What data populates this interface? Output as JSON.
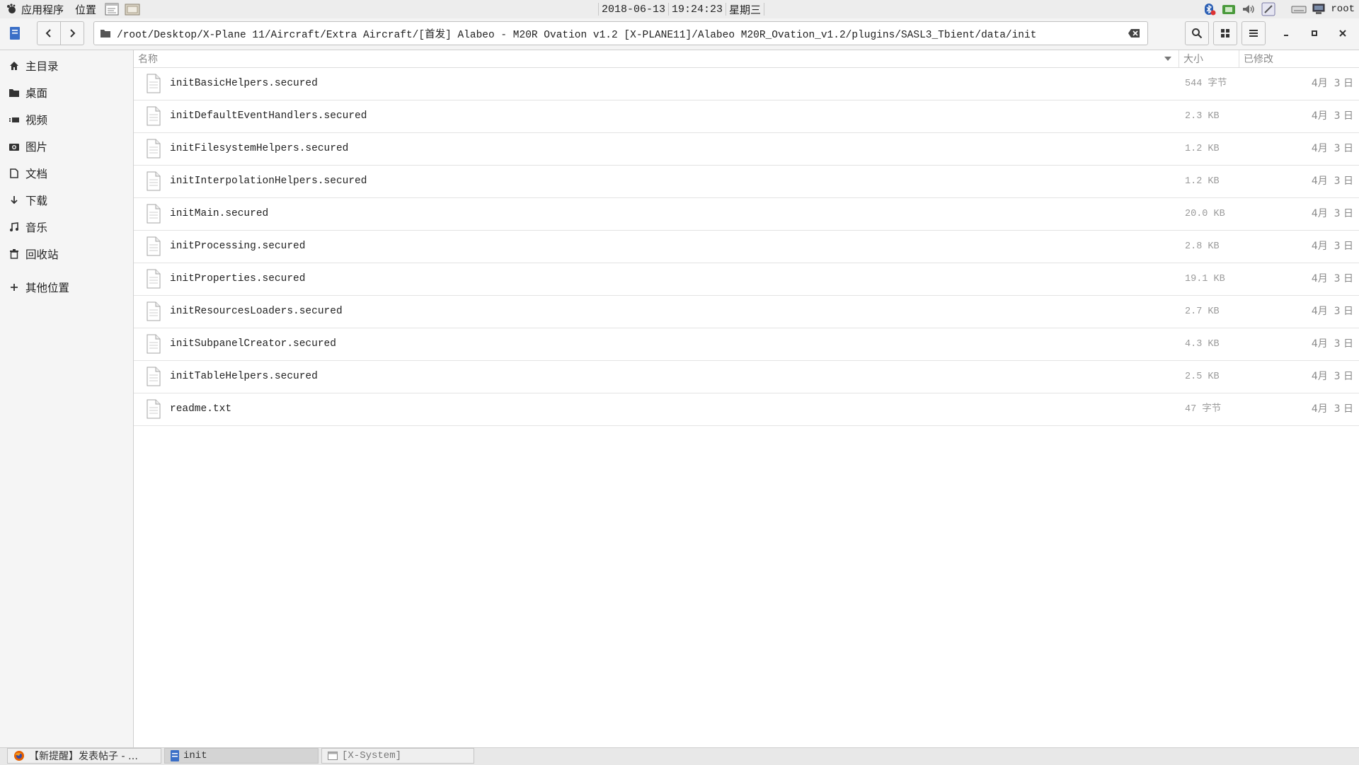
{
  "top_panel": {
    "apps_menu": "应用程序",
    "places_menu": "位置",
    "date": "2018-06-13",
    "time": "19:24:23",
    "weekday": "星期三",
    "user": "root"
  },
  "header": {
    "path": "/root/Desktop/X-Plane 11/Aircraft/Extra Aircraft/[首发] Alabeo - M20R Ovation v1.2 [X-PLANE11]/Alabeo M20R_Ovation_v1.2/plugins/SASL3_Tbient/data/init"
  },
  "sidebar": {
    "items": [
      {
        "label": "主目录",
        "icon": "home-icon"
      },
      {
        "label": "桌面",
        "icon": "folder-icon"
      },
      {
        "label": "视频",
        "icon": "video-icon"
      },
      {
        "label": "图片",
        "icon": "camera-icon"
      },
      {
        "label": "文档",
        "icon": "document-icon"
      },
      {
        "label": "下载",
        "icon": "download-icon"
      },
      {
        "label": "音乐",
        "icon": "music-icon"
      },
      {
        "label": "回收站",
        "icon": "trash-icon"
      },
      {
        "label": "其他位置",
        "icon": "plus-icon"
      }
    ]
  },
  "columns": {
    "name": "名称",
    "size": "大小",
    "modified": "已修改"
  },
  "files": [
    {
      "name": "initBasicHelpers.secured",
      "size": "544 字节",
      "modified": "4月  3 日"
    },
    {
      "name": "initDefaultEventHandlers.secured",
      "size": "2.3 KB",
      "modified": "4月  3 日"
    },
    {
      "name": "initFilesystemHelpers.secured",
      "size": "1.2 KB",
      "modified": "4月  3 日"
    },
    {
      "name": "initInterpolationHelpers.secured",
      "size": "1.2 KB",
      "modified": "4月  3 日"
    },
    {
      "name": "initMain.secured",
      "size": "20.0 KB",
      "modified": "4月  3 日"
    },
    {
      "name": "initProcessing.secured",
      "size": "2.8 KB",
      "modified": "4月  3 日"
    },
    {
      "name": "initProperties.secured",
      "size": "19.1 KB",
      "modified": "4月  3 日"
    },
    {
      "name": "initResourcesLoaders.secured",
      "size": "2.7 KB",
      "modified": "4月  3 日"
    },
    {
      "name": "initSubpanelCreator.secured",
      "size": "4.3 KB",
      "modified": "4月  3 日"
    },
    {
      "name": "initTableHelpers.secured",
      "size": "2.5 KB",
      "modified": "4月  3 日"
    },
    {
      "name": "readme.txt",
      "size": "47 字节",
      "modified": "4月  3 日"
    }
  ],
  "taskbar": {
    "tasks": [
      {
        "label": "【新提醒】发表帖子 - …",
        "icon": "firefox-icon"
      },
      {
        "label": "init",
        "icon": "files-icon"
      },
      {
        "label": "[X-System]",
        "icon": "window-icon"
      }
    ]
  }
}
